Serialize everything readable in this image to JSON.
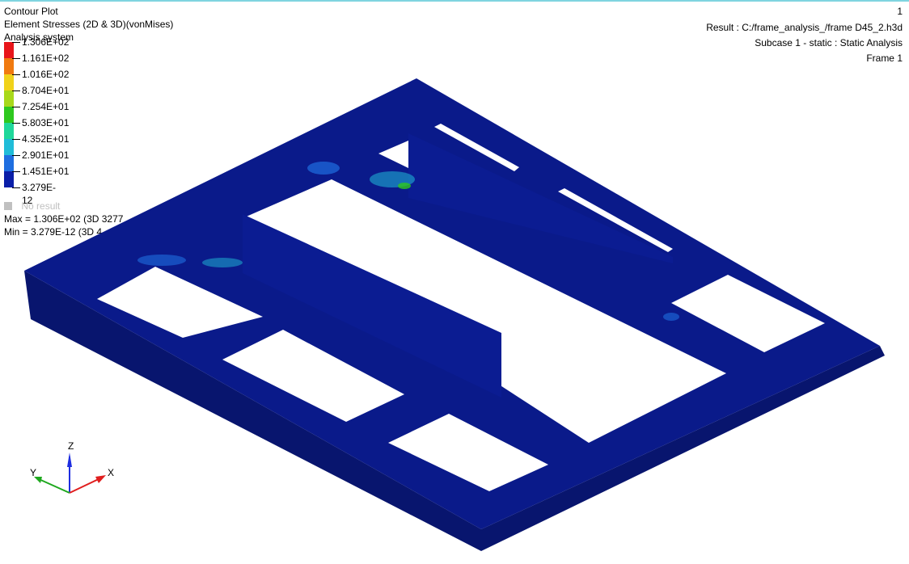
{
  "header": {
    "title": "Contour Plot",
    "result_type": "Element Stresses (2D & 3D)(vonMises)",
    "system": "Analysis system"
  },
  "legend": {
    "values": [
      "1.306E+02",
      "1.161E+02",
      "1.016E+02",
      "8.704E+01",
      "7.254E+01",
      "5.803E+01",
      "4.352E+01",
      "2.901E+01",
      "1.451E+01",
      "3.279E-12"
    ],
    "colors": [
      "#e8151a",
      "#f07a10",
      "#f0d21a",
      "#a8d81a",
      "#2ec81e",
      "#1fd79a",
      "#20bcd8",
      "#1e6ee0",
      "#0a1ea8"
    ],
    "no_result_label": "No result",
    "no_result_color": "#c0c0c0",
    "max_text": "Max = 1.306E+02 (3D 3277",
    "min_text": "Min = 3.279E-12 (3D 4"
  },
  "info": {
    "page": "1",
    "result": "Result : C:/frame_analysis_/frame D45_2.h3d",
    "subcase": "Subcase 1 - static : Static Analysis",
    "frame": "Frame 1"
  },
  "triad": {
    "z": "Z",
    "y": "Y",
    "x": "X"
  },
  "model_color": "#0a1a8a"
}
